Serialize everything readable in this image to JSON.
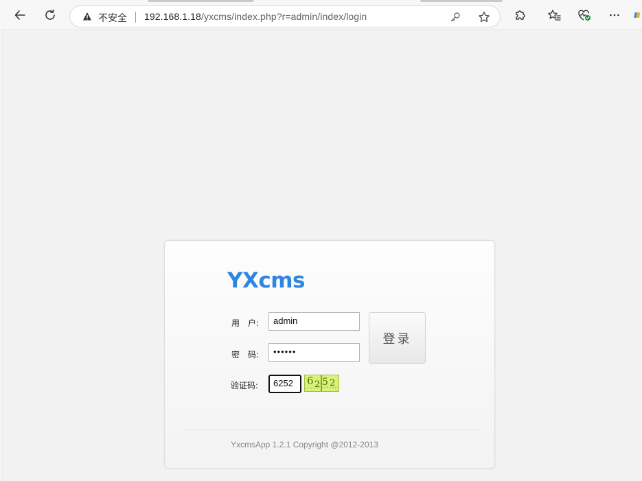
{
  "browser": {
    "address_security": "不安全",
    "url_host": "192.168.1.18",
    "url_path": "/yxcms/index.php?r=admin/index/login"
  },
  "login": {
    "logo": "YXcms",
    "username_label": "用　户:",
    "username_value": "admin",
    "password_label": "密　码:",
    "password_mask": "••••••",
    "captcha_label": "验证码:",
    "captcha_value": "6252",
    "captcha_image_text": "6252",
    "submit_label": "登录",
    "copyright": "YxcmsApp 1.2.1 Copyright @2012-2013"
  },
  "colors": {
    "logo": "#2f86e0",
    "captcha_bg": "#d9f27a"
  }
}
